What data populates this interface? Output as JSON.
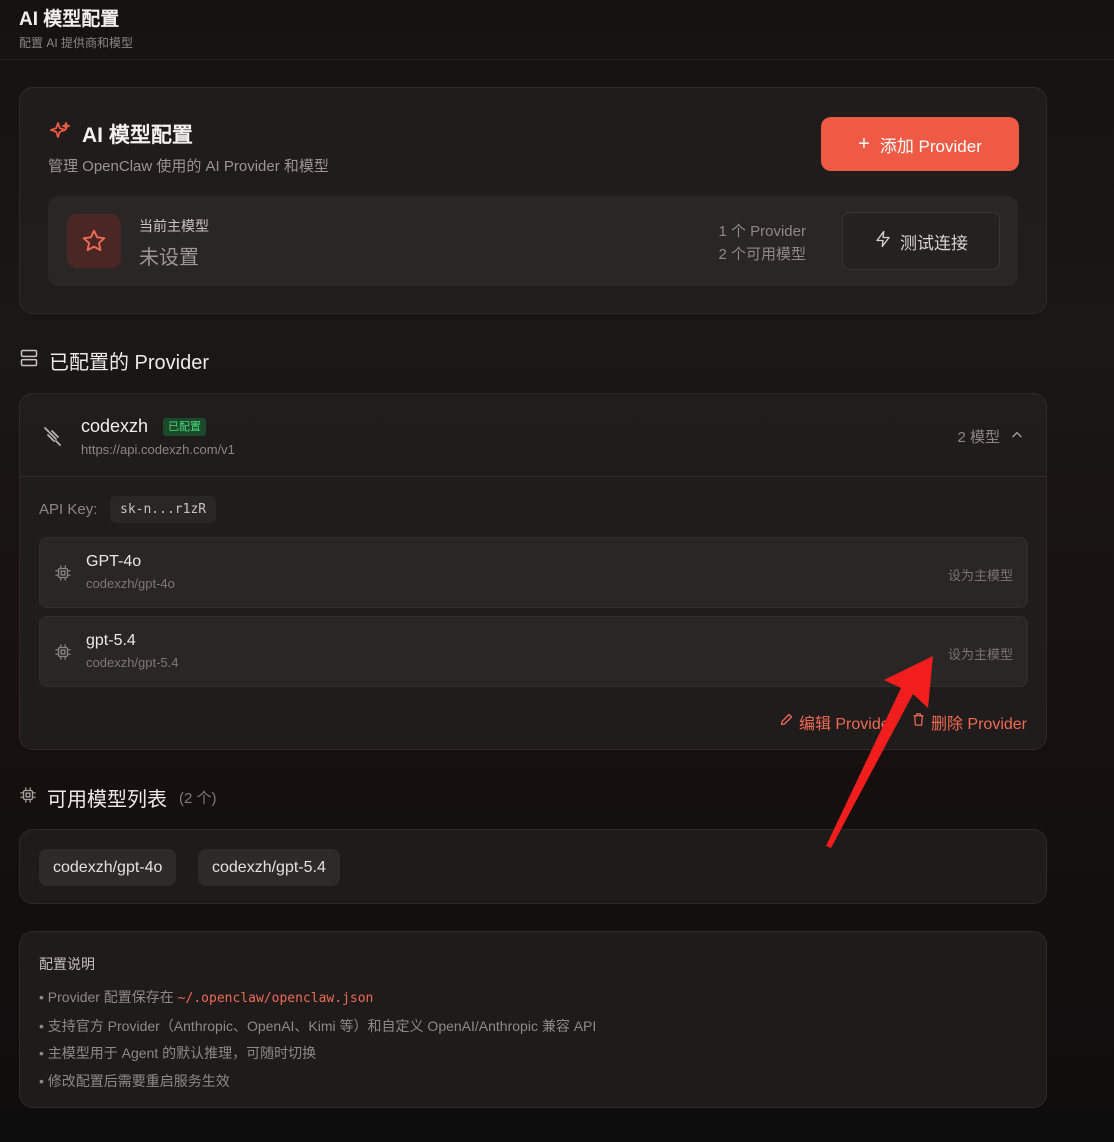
{
  "header": {
    "title": "AI 模型配置",
    "subtitle": "配置 AI 提供商和模型"
  },
  "hero": {
    "title": "AI 模型配置",
    "subtitle": "管理 OpenClaw 使用的 AI Provider 和模型",
    "add_button": "添加 Provider",
    "main_model_label": "当前主模型",
    "main_model_value": "未设置",
    "stats_providers": "1 个 Provider",
    "stats_models": "2 个可用模型",
    "test_button": "测试连接"
  },
  "providers_section": {
    "title": "已配置的 Provider",
    "providers": [
      {
        "name": "codexzh",
        "badge": "已配置",
        "url": "https://api.codexzh.com/v1",
        "model_count": "2 模型",
        "api_key_label": "API Key:",
        "api_key": "sk-n...r1zR",
        "models": [
          {
            "name": "GPT-4o",
            "id": "codexzh/gpt-4o",
            "action": "设为主模型"
          },
          {
            "name": "gpt-5.4",
            "id": "codexzh/gpt-5.4",
            "action": "设为主模型"
          }
        ],
        "edit_label": "编辑 Provider",
        "delete_label": "删除 Provider"
      }
    ]
  },
  "models_section": {
    "title": "可用模型列表",
    "count": "(2 个)",
    "chips": [
      "codexzh/gpt-4o",
      "codexzh/gpt-5.4"
    ]
  },
  "notes": {
    "title": "配置说明",
    "item1_prefix": "• Provider 配置保存在 ",
    "item1_code": "~/.openclaw/openclaw.json",
    "item2": "• 支持官方 Provider（Anthropic、OpenAI、Kimi 等）和自定义 OpenAI/Anthropic 兼容 API",
    "item3": "• 主模型用于 Agent 的默认推理，可随时切换",
    "item4": "• 修改配置后需要重启服务生效"
  },
  "colors": {
    "accent": "#ef5a45",
    "badge_green": "#4ed77c",
    "annotation_arrow": "#f21e1e"
  }
}
